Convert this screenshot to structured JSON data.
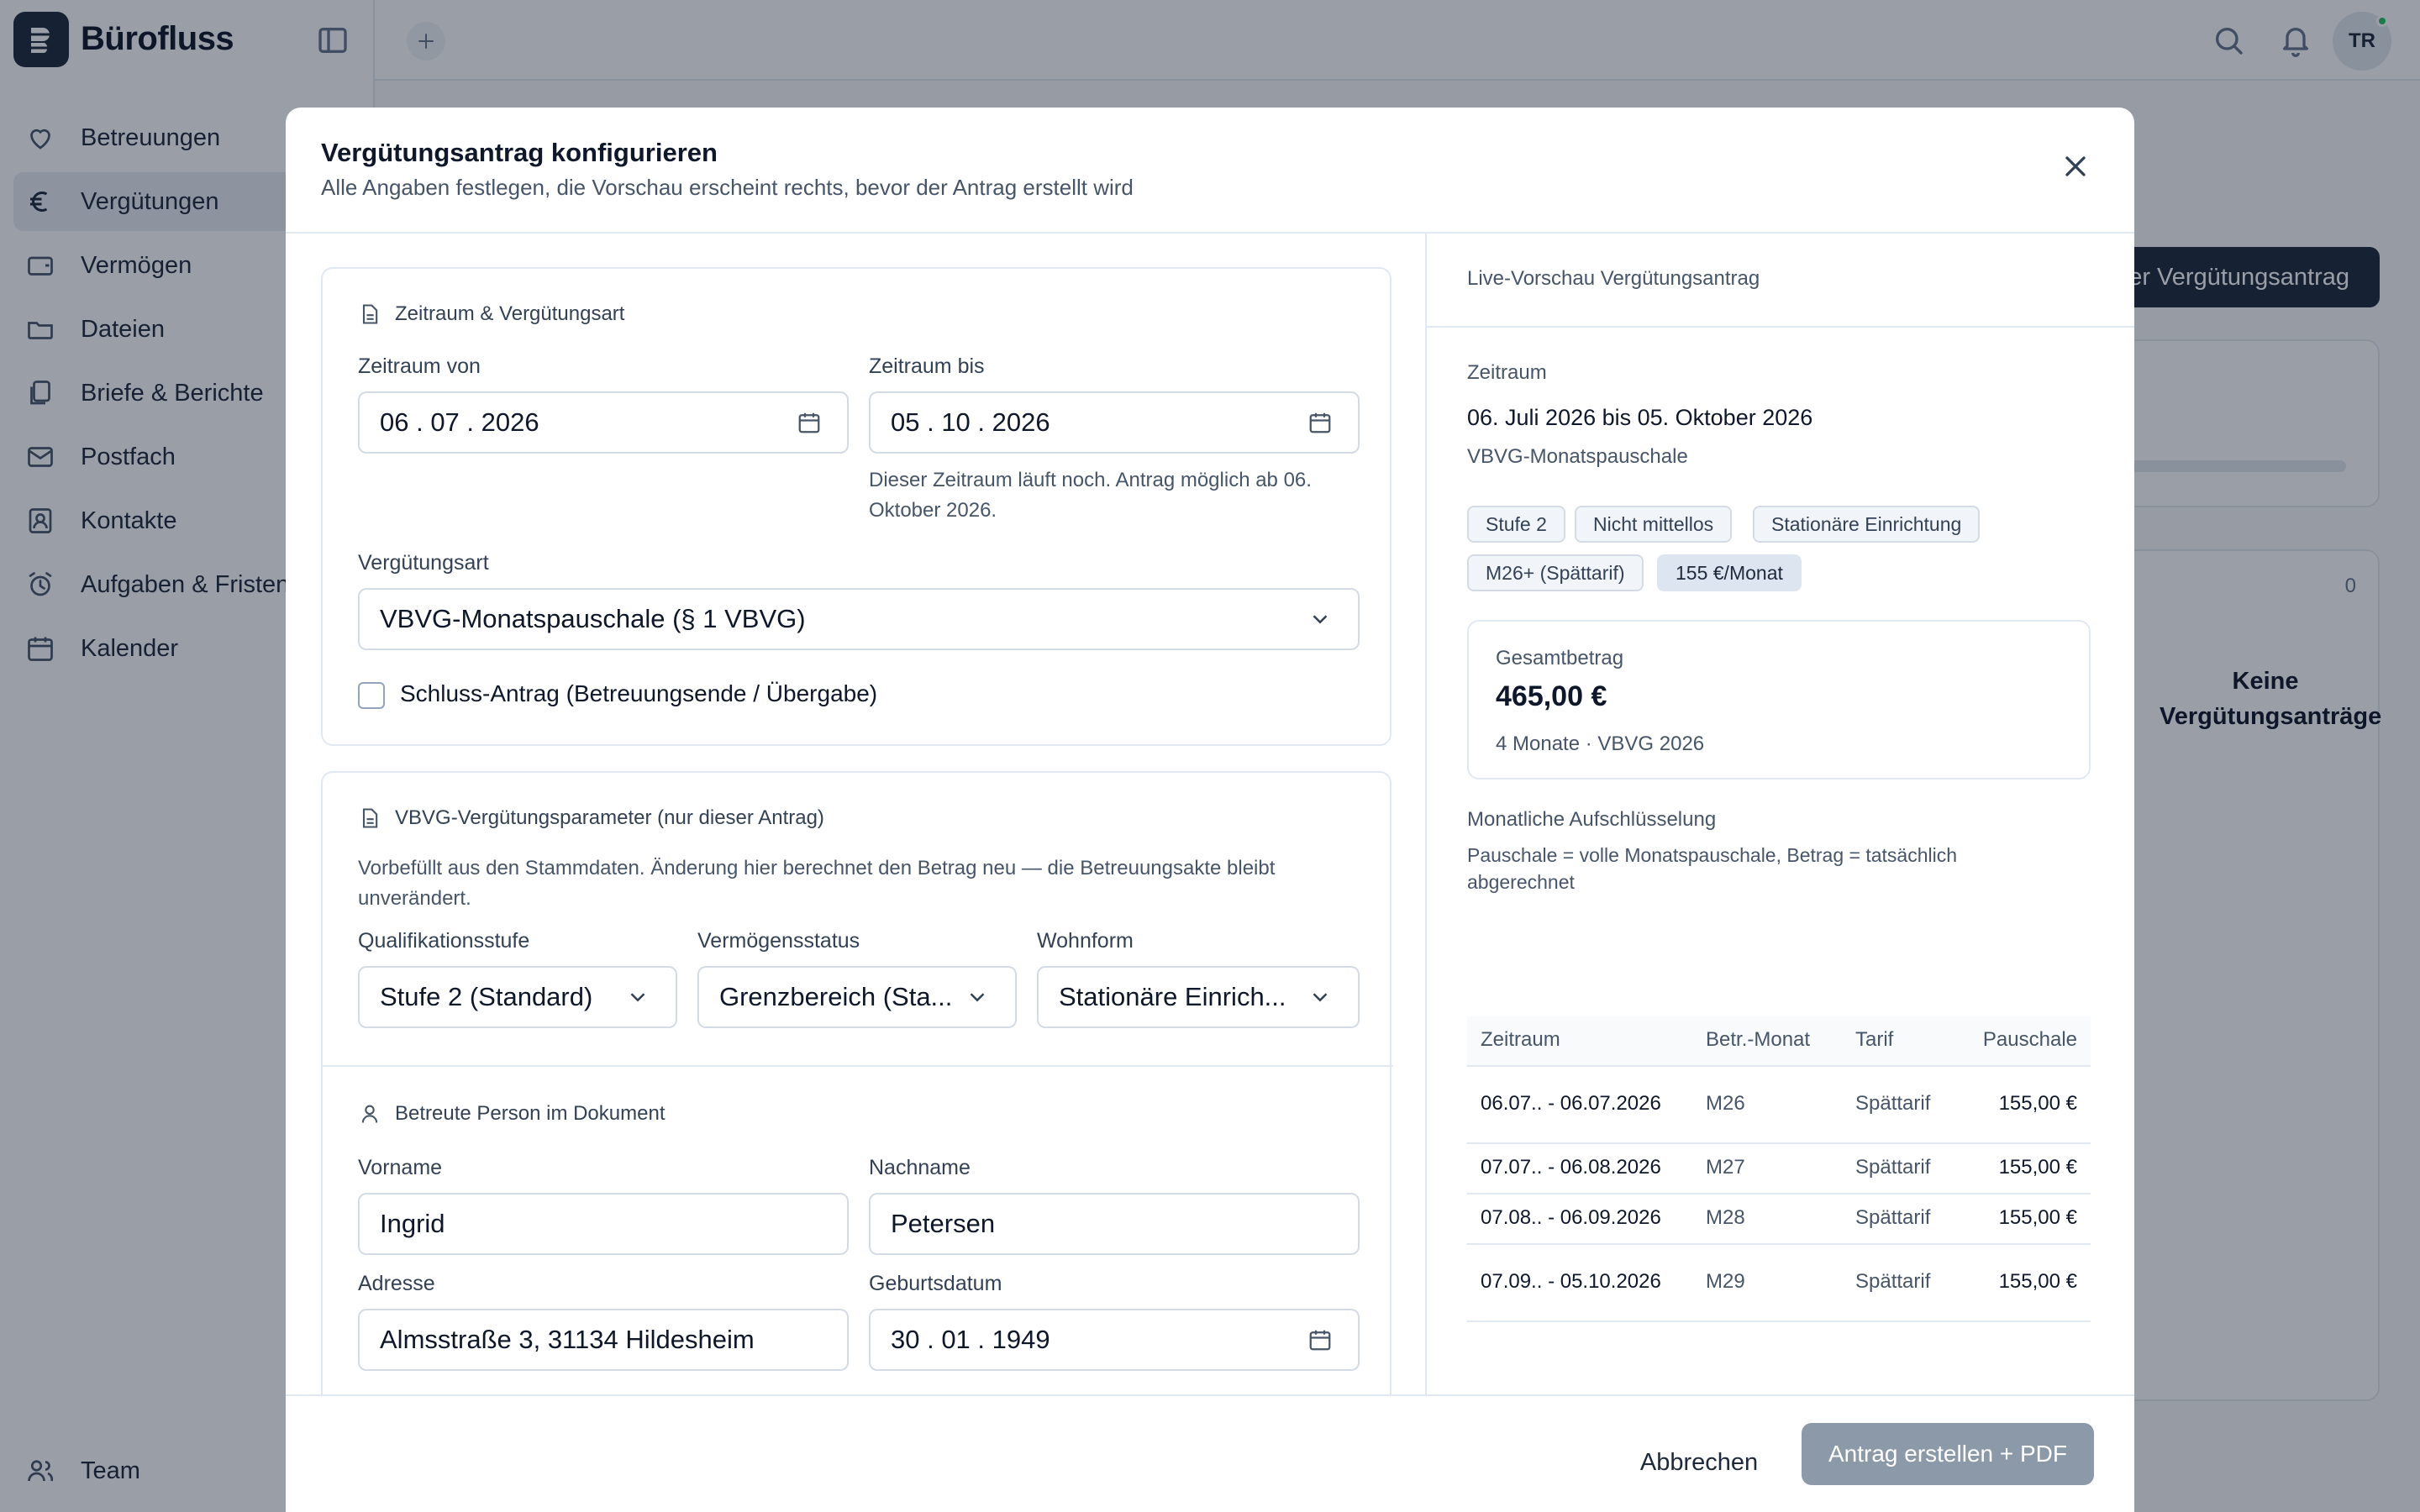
{
  "app": {
    "name": "Bürofluss",
    "avatar_initials": "TR",
    "colors": {
      "brand": "#1e293b",
      "online": "#22c55e",
      "accent_chip": "#dde6f0"
    }
  },
  "sidebar": {
    "items": [
      {
        "label": "Betreuungen",
        "icon": "heart-hand-icon"
      },
      {
        "label": "Vergütungen",
        "icon": "euro-icon",
        "active": true
      },
      {
        "label": "Vermögen",
        "icon": "wallet-icon"
      },
      {
        "label": "Dateien",
        "icon": "folder-icon"
      },
      {
        "label": "Briefe & Berichte",
        "icon": "documents-icon"
      },
      {
        "label": "Postfach",
        "icon": "mail-icon"
      },
      {
        "label": "Kontakte",
        "icon": "contact-icon"
      },
      {
        "label": "Aufgaben & Fristen",
        "icon": "alarm-icon"
      },
      {
        "label": "Kalender",
        "icon": "calendar-icon"
      }
    ],
    "team_label": "Team"
  },
  "background": {
    "new_button": "Neuer Vergütungsantrag",
    "list_count": "0",
    "empty_title": "Keine Vergütungsanträge"
  },
  "modal": {
    "title": "Vergütungsantrag konfigurieren",
    "subtitle": "Alle Angaben festlegen, die Vorschau erscheint rechts, bevor der Antrag erstellt wird",
    "period_section": {
      "title": "Zeitraum & Vergütungsart",
      "from_label": "Zeitraum von",
      "from_value": "06 . 07 . 2026",
      "to_label": "Zeitraum bis",
      "to_value": "05 . 10 . 2026",
      "hint": "Dieser Zeitraum läuft noch. Antrag möglich ab 06. Oktober 2026.",
      "type_label": "Vergütungsart",
      "type_value": "VBVG-Monatspauschale (§ 1 VBVG)",
      "final_checkbox": "Schluss-Antrag (Betreuungsende / Übergabe)"
    },
    "params_section": {
      "title": "VBVG-Vergütungsparameter (nur dieser Antrag)",
      "hint": "Vorbefüllt aus den Stammdaten. Änderung hier berechnet den Betrag neu — die Betreuungsakte bleibt unverändert.",
      "qual_label": "Qualifikationsstufe",
      "qual_value": "Stufe 2 (Standard)",
      "asset_label": "Vermögensstatus",
      "asset_value": "Grenzbereich (Sta...",
      "living_label": "Wohnform",
      "living_value": "Stationäre Einrich..."
    },
    "person_section": {
      "title": "Betreute Person im Dokument",
      "firstname_label": "Vorname",
      "firstname_value": "Ingrid",
      "lastname_label": "Nachname",
      "lastname_value": "Petersen",
      "address_label": "Adresse",
      "address_value": "Almsstraße 3, 31134 Hildesheim",
      "birth_label": "Geburtsdatum",
      "birth_value": "30 . 01 . 1949"
    },
    "preview": {
      "title": "Live-Vorschau Vergütungsantrag",
      "period_label": "Zeitraum",
      "period_value": "06. Juli 2026 bis 05. Oktober 2026",
      "type_value": "VBVG-Monatspauschale",
      "chips": [
        "Stufe 2",
        "Nicht mittellos",
        "Stationäre Einrichtung",
        "M26+ (Spättarif)",
        "155 €/Monat"
      ],
      "total_label": "Gesamtbetrag",
      "total_value": "465,00 €",
      "total_meta": "4 Monate · VBVG 2026",
      "breakdown_title": "Monatliche Aufschlüsselung",
      "breakdown_hint": "Pauschale = volle Monatspauschale, Betrag = tatsächlich abgerechnet",
      "columns": [
        "Zeitraum",
        "Betr.-Monat",
        "Tarif",
        "Pauschale"
      ],
      "rows": [
        {
          "period": "06.07.. - 06.07.2026",
          "month": "M26",
          "tariff": "Spättarif",
          "amount": "155,00 €"
        },
        {
          "period": "07.07.. - 06.08.2026",
          "month": "M27",
          "tariff": "Spättarif",
          "amount": "155,00 €"
        },
        {
          "period": "07.08.. - 06.09.2026",
          "month": "M28",
          "tariff": "Spättarif",
          "amount": "155,00 €"
        },
        {
          "period": "07.09.. - 05.10.2026",
          "month": "M29",
          "tariff": "Spättarif",
          "amount": "155,00 €"
        }
      ]
    },
    "cancel_label": "Abbrechen",
    "submit_label": "Antrag erstellen + PDF"
  }
}
